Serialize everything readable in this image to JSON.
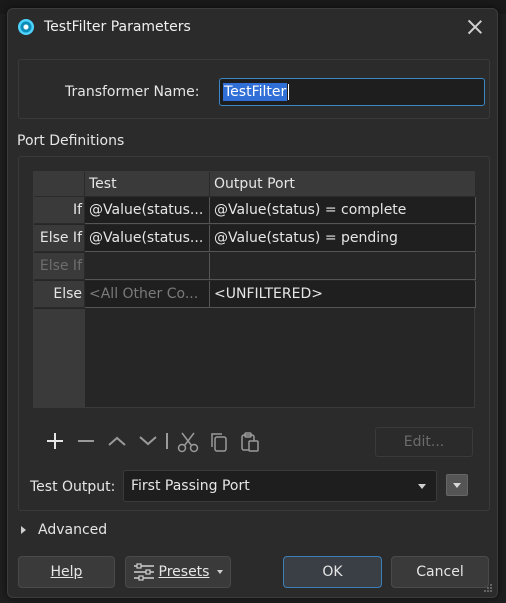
{
  "window": {
    "title": "TestFilter Parameters"
  },
  "transformer": {
    "label": "Transformer Name:",
    "value": "TestFilter"
  },
  "ports": {
    "section_label": "Port Definitions",
    "columns": [
      "Test",
      "Output Port"
    ],
    "rows": [
      {
        "head": "If",
        "test": "@Value(status...",
        "output": "@Value(status) = complete"
      },
      {
        "head": "Else If",
        "test": "@Value(status...",
        "output": "@Value(status) = pending"
      },
      {
        "head": "Else If",
        "test": "",
        "output": ""
      },
      {
        "head": "Else",
        "test": "<All Other Co...",
        "output": "<UNFILTERED>"
      }
    ],
    "edit_label": "Edit..."
  },
  "test_output": {
    "label": "Test Output:",
    "value": "First Passing Port"
  },
  "advanced": {
    "label": "Advanced"
  },
  "buttons": {
    "help": "Help",
    "presets": "Presets",
    "ok": "OK",
    "cancel": "Cancel"
  },
  "colors": {
    "accent": "#3b86c4",
    "selection": "#2f6fd6",
    "background": "#2b2b2b"
  }
}
